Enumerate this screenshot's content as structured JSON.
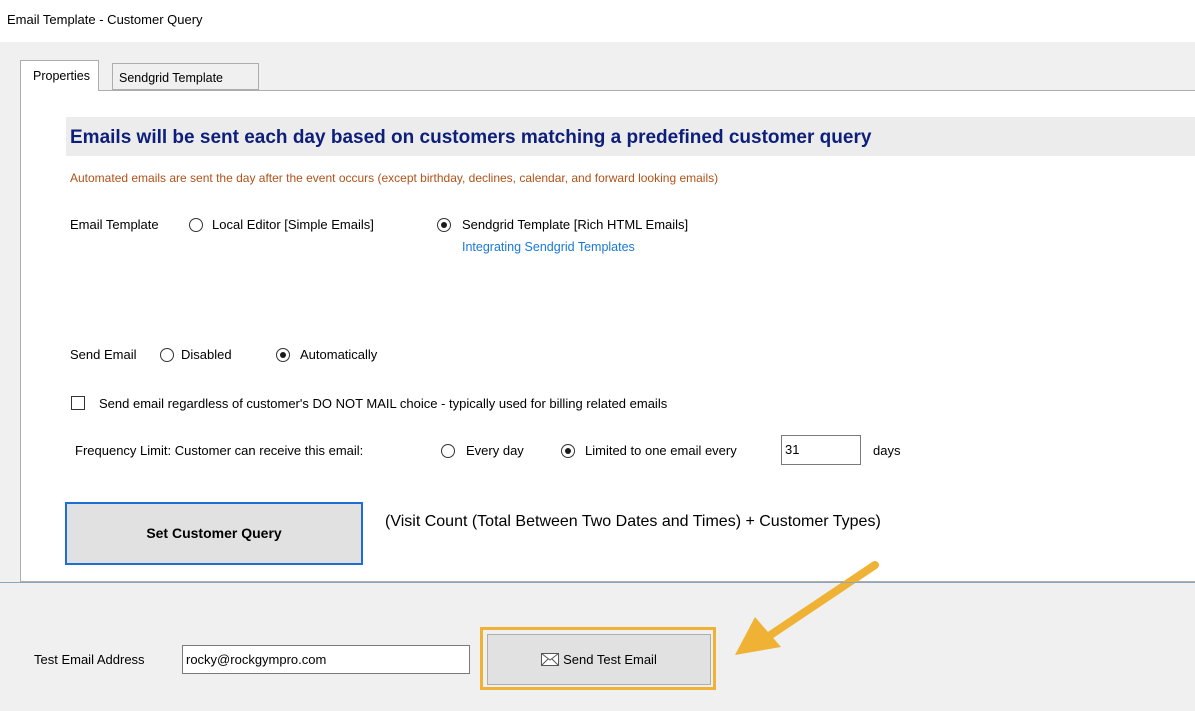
{
  "window": {
    "title": "Email Template - Customer Query"
  },
  "tabs": [
    {
      "label": "Properties",
      "active": true
    },
    {
      "label": "Sendgrid Template",
      "active": false
    }
  ],
  "properties": {
    "banner": "Emails will be sent each day based on customers matching a predefined customer query",
    "notice": "Automated emails are sent the day after the event occurs (except birthday, declines, calendar, and forward looking emails)",
    "email_template": {
      "label": "Email Template",
      "options": [
        {
          "label": "Local Editor [Simple Emails]",
          "checked": false
        },
        {
          "label": "Sendgrid Template [Rich HTML Emails]",
          "checked": true
        }
      ],
      "help_link": "Integrating Sendgrid Templates"
    },
    "send_email": {
      "label": "Send Email",
      "options": [
        {
          "label": "Disabled",
          "checked": false
        },
        {
          "label": "Automatically",
          "checked": true
        }
      ]
    },
    "do_not_mail_override": {
      "label": "Send email regardless of customer's DO NOT MAIL choice - typically used for billing related emails",
      "checked": false
    },
    "frequency": {
      "label": "Frequency Limit: Customer can receive this email:",
      "options": [
        {
          "label": "Every day",
          "checked": false
        },
        {
          "label": "Limited to one email every",
          "checked": true
        }
      ],
      "days_value": "31",
      "days_unit": "days"
    },
    "query": {
      "button_label": "Set Customer Query",
      "description": "(Visit Count (Total Between Two Dates and Times) + Customer Types)"
    }
  },
  "test_email": {
    "label": "Test Email Address",
    "value": "rocky@rockgympro.com",
    "button_label": "Send Test Email",
    "button_icon": "envelope-icon"
  },
  "colors": {
    "banner_text": "#0d1f7a",
    "notice_text": "#b0521a",
    "link": "#1a78d4",
    "highlight": "#f0b235",
    "primary_border": "#1f6ed4"
  }
}
